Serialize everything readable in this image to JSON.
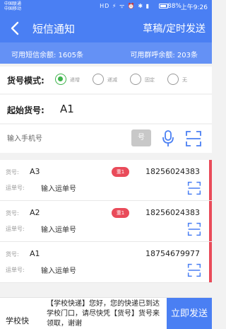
{
  "status_bar": {
    "carrier1": "中国联通",
    "carrier2": "中国移动",
    "icons": "HD ⚡ ᯤ ⏰ ✱ ▮",
    "battery": "88%",
    "time": "上午9:26"
  },
  "header": {
    "title": "短信通知",
    "action": "草稿/定时发送"
  },
  "balance": {
    "sms": "可用短信余额: 1605条",
    "call": "可用群呼余额: 203条"
  },
  "mode": {
    "label": "货号模式:",
    "options": [
      {
        "label": "递增",
        "checked": true
      },
      {
        "label": "递减",
        "checked": false
      },
      {
        "label": "固定",
        "checked": false
      },
      {
        "label": "无",
        "checked": false
      }
    ]
  },
  "start": {
    "label": "起始货号:",
    "value": "A1"
  },
  "phone_input": {
    "placeholder": "输入手机号",
    "hao_button": "号"
  },
  "items": [
    {
      "code_label": "货号:",
      "code": "A3",
      "tag": "重1",
      "phone": "18256024383",
      "waybill_label": "运单号:",
      "waybill_placeholder": "输入运单号"
    },
    {
      "code_label": "货号:",
      "code": "A2",
      "tag": "重1",
      "phone": "18256024383",
      "waybill_label": "运单号:",
      "waybill_placeholder": "输入运单号"
    },
    {
      "code_label": "货号:",
      "code": "A1",
      "tag": "",
      "phone": "18754679977",
      "waybill_label": "运单号:",
      "waybill_placeholder": "输入运单号"
    }
  ],
  "bottom": {
    "template_name": "学校快",
    "content": "【学校快递】您好，您的快递已到达学校门口，请尽快凭【货号】货号来领取，谢谢",
    "send": "立即发送"
  },
  "colors": {
    "primary": "#4a7ff3",
    "balance_bar": "#6491f5",
    "accent_red": "#e94b5a",
    "radio_green": "#3db34a"
  }
}
